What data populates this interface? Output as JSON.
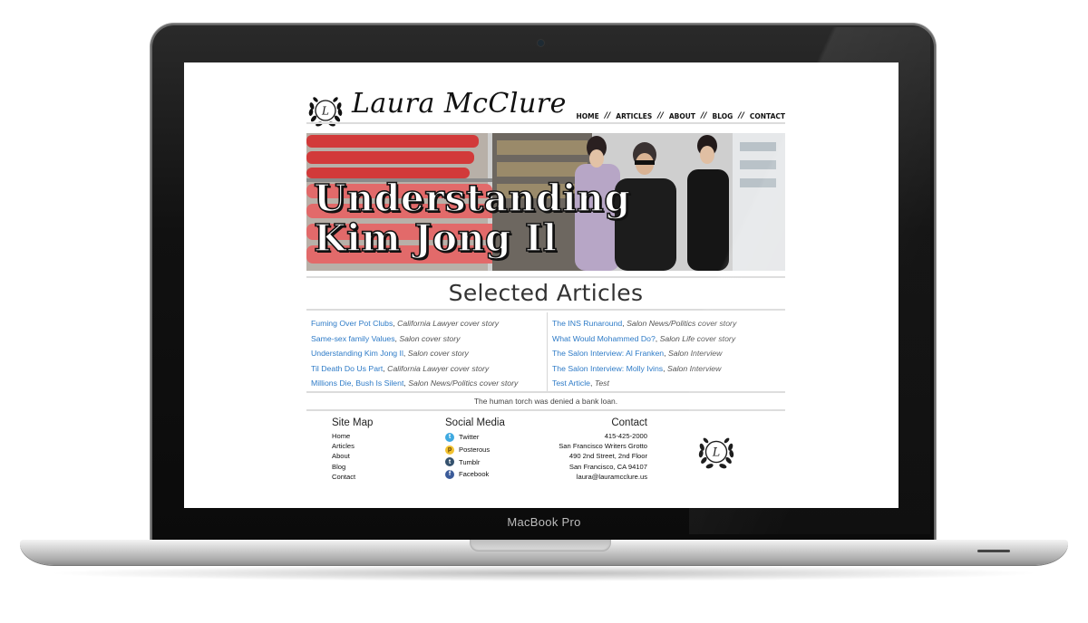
{
  "device": {
    "label": "MacBook Pro"
  },
  "site": {
    "logo_letter": "L",
    "title": "Laura McClure",
    "nav": [
      "HOME",
      "ARTICLES",
      "ABOUT",
      "BLOG",
      "CONTACT"
    ],
    "nav_separator": "//",
    "hero": {
      "title": "Understanding\nKim Jong Il"
    },
    "articles_heading": "Selected Articles",
    "articles_left": [
      {
        "title": "Fuming Over Pot Clubs",
        "pub": "California Lawyer cover story"
      },
      {
        "title": "Same-sex family Values",
        "pub": "Salon cover story"
      },
      {
        "title": "Understanding Kim Jong Il",
        "pub": "Salon cover story"
      },
      {
        "title": "Til Death Do Us Part",
        "pub": "California Lawyer cover story"
      },
      {
        "title": "Millions Die, Bush Is Silent",
        "pub": "Salon News/Politics cover story"
      }
    ],
    "articles_right": [
      {
        "title": "The INS Runaround",
        "pub": "Salon News/Politics cover story"
      },
      {
        "title": "What Would Mohammed Do?",
        "pub": "Salon Life cover story"
      },
      {
        "title": "The Salon Interview: Al Franken",
        "pub": "Salon Interview"
      },
      {
        "title": "The Salon Interview: Molly Ivins",
        "pub": "Salon Interview"
      },
      {
        "title": "Test Article",
        "pub": "Test"
      }
    ],
    "tagline": "The human torch was denied a bank loan.",
    "footer": {
      "sitemap": {
        "heading": "Site Map",
        "items": [
          "Home",
          "Articles",
          "About",
          "Blog",
          "Contact"
        ]
      },
      "social": {
        "heading": "Social Media",
        "items": [
          {
            "label": "Twitter",
            "icon": "twitter-icon",
            "color": "#3fa9e0"
          },
          {
            "label": "Posterous",
            "icon": "posterous-icon",
            "color": "#f2c230"
          },
          {
            "label": "Tumblr",
            "icon": "tumblr-icon",
            "color": "#35526e"
          },
          {
            "label": "Facebook",
            "icon": "facebook-icon",
            "color": "#3b5b99"
          }
        ]
      },
      "contact": {
        "heading": "Contact",
        "lines": [
          "415-425-2000",
          "San Francisco Writers Grotto",
          "490 2nd Street, 2nd Floor",
          "San Francisco, CA 94107",
          "laura@lauramcclure.us"
        ]
      }
    }
  }
}
